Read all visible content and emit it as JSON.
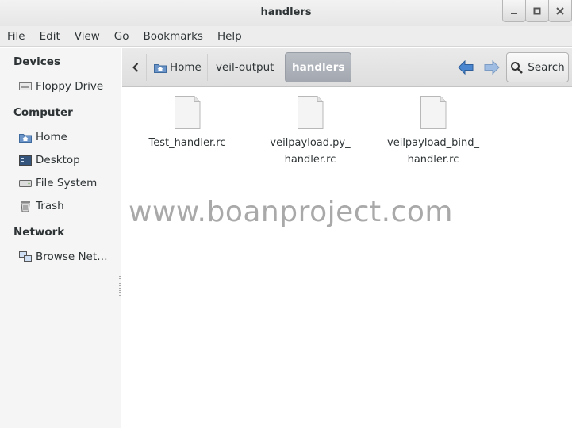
{
  "window": {
    "title": "handlers"
  },
  "menubar": {
    "items": [
      "File",
      "Edit",
      "View",
      "Go",
      "Bookmarks",
      "Help"
    ]
  },
  "sidebar": {
    "devices_header": "Devices",
    "devices": [
      {
        "label": "Floppy Drive",
        "icon": "floppy-drive-icon"
      }
    ],
    "computer_header": "Computer",
    "computer": [
      {
        "label": "Home",
        "icon": "home-folder-icon"
      },
      {
        "label": "Desktop",
        "icon": "desktop-icon"
      },
      {
        "label": "File System",
        "icon": "drive-icon"
      },
      {
        "label": "Trash",
        "icon": "trash-icon"
      }
    ],
    "network_header": "Network",
    "network": [
      {
        "label": "Browse Net…",
        "icon": "network-icon"
      }
    ]
  },
  "toolbar": {
    "breadcrumbs": [
      "Home",
      "veil-output",
      "handlers"
    ],
    "search_label": "Search"
  },
  "files": [
    {
      "name_line1": "Test_handler.rc",
      "name_line2": ""
    },
    {
      "name_line1": "veilpayload.py_",
      "name_line2": "handler.rc"
    },
    {
      "name_line1": "veilpayload_bind_",
      "name_line2": "handler.rc"
    }
  ],
  "watermark": "www.boanproject.com",
  "colors": {
    "nav_arrow": "#4a86cf",
    "active_crumb": "#a8adb5"
  }
}
